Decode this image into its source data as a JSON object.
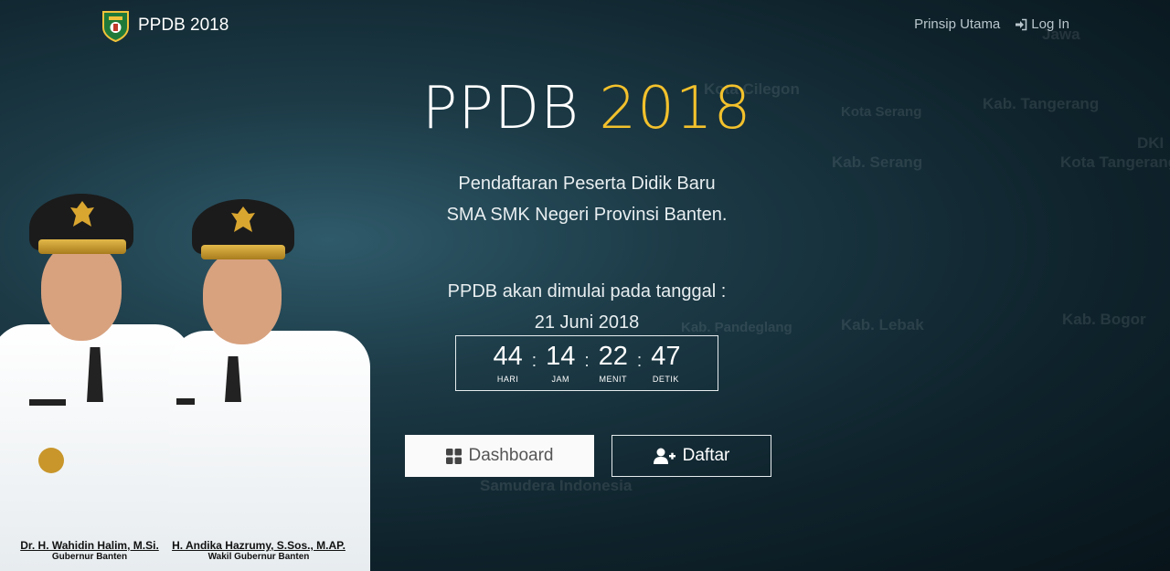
{
  "nav": {
    "brand": "PPDB 2018",
    "links": [
      {
        "label": "Prinsip Utama"
      },
      {
        "label": "Log In",
        "icon": "sign-in-icon"
      }
    ]
  },
  "hero": {
    "title_main": "PPDB",
    "title_year": "2018",
    "subtitle_line1": "Pendaftaran Peserta Didik Baru",
    "subtitle_line2": "SMA SMK Negeri Provinsi Banten.",
    "start_line1": "PPDB akan dimulai pada tanggal :",
    "start_line2": "21 Juni 2018"
  },
  "countdown": {
    "days": "44",
    "days_label": "HARI",
    "hours": "14",
    "hours_label": "JAM",
    "minutes": "22",
    "minutes_label": "MENIT",
    "seconds": "47",
    "seconds_label": "DETIK",
    "separator": ":"
  },
  "buttons": {
    "dashboard": "Dashboard",
    "daftar": "Daftar"
  },
  "governors": [
    {
      "name": "Dr. H. Wahidin Halim, M.Si.",
      "role": "Gubernur Banten"
    },
    {
      "name": "H. Andika Hazrumy, S.Sos., M.AP.",
      "role": "Wakil Gubernur Banten"
    }
  ],
  "map_labels": [
    "Kota Cilegon",
    "Kota Serang",
    "Kab. Tangerang",
    "Kab. Serang",
    "Kota Tangerang",
    "Kab. Lebak",
    "Kab. Bogor",
    "DKI",
    "Samudera Indonesia",
    "Kab. Pandeglang",
    "Jawa"
  ],
  "colors": {
    "accent": "#f3c12c",
    "background": "#0f232c"
  }
}
